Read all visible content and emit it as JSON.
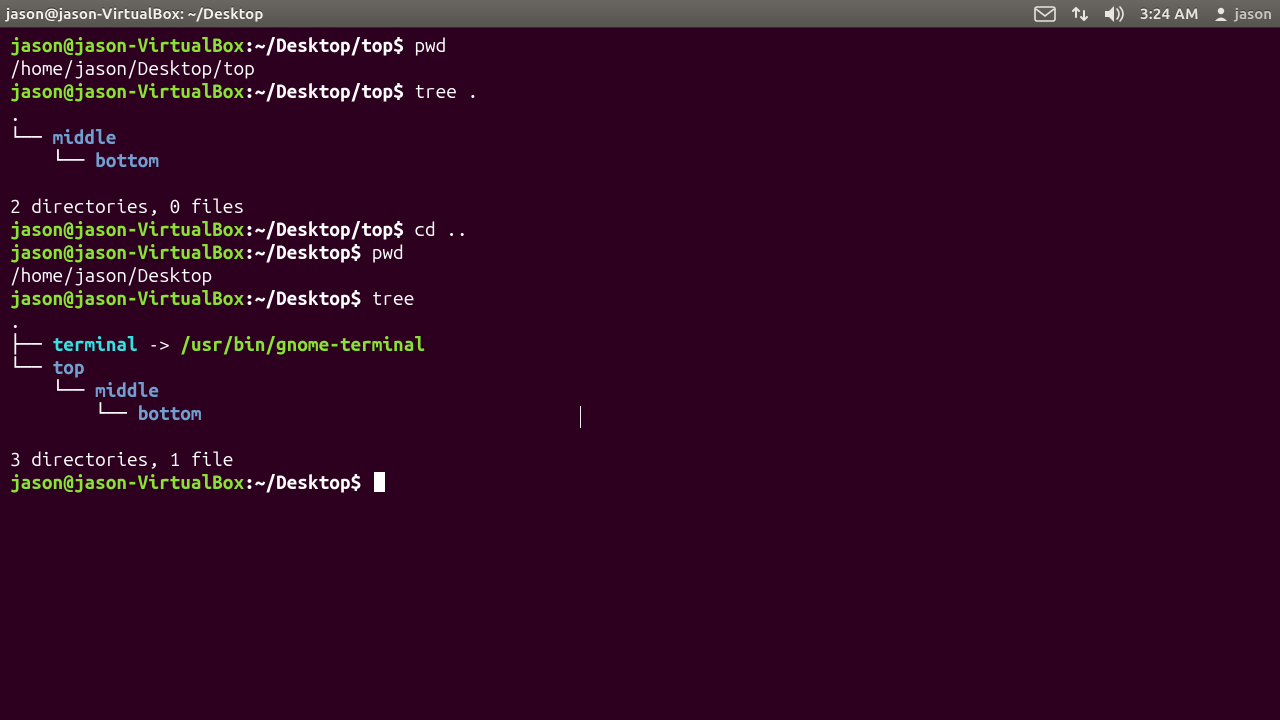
{
  "panel": {
    "title": "jason@jason-VirtualBox: ~/Desktop",
    "clock": "3:24 AM",
    "username": "jason"
  },
  "prompts": {
    "user": "jason@jason-VirtualBox",
    "sep": ":",
    "path_top": "~/Desktop/top",
    "path_desktop": "~/Desktop",
    "dollar": "$"
  },
  "commands": {
    "pwd": "pwd",
    "tree_dot": "tree .",
    "cd_up": "cd ..",
    "tree": "tree"
  },
  "outputs": {
    "pwd_top": "/home/jason/Desktop/top",
    "pwd_desktop": "/home/jason/Desktop",
    "dot": ".",
    "summary1": "2 directories, 0 files",
    "summary2": "3 directories, 1 file"
  },
  "tree1": {
    "middle": "middle",
    "bottom": "bottom"
  },
  "tree2": {
    "terminal_link": "terminal",
    "terminal_arrow": " -> ",
    "terminal_target": "/usr/bin/gnome-terminal",
    "top": "top",
    "middle": "middle",
    "bottom": "bottom"
  },
  "tree_glyphs": {
    "end": "└── ",
    "mid": "├── ",
    "vert": "│   ",
    "sp": "    "
  }
}
